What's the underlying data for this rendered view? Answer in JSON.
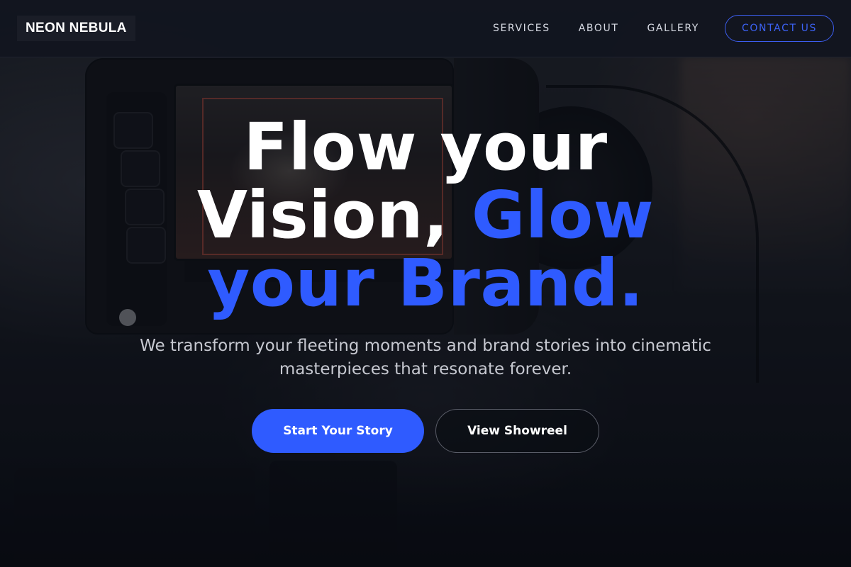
{
  "brand": {
    "logo_text": "NEON NEBULA"
  },
  "nav": {
    "links": [
      {
        "label": "SERVICES"
      },
      {
        "label": "ABOUT"
      },
      {
        "label": "GALLERY"
      }
    ],
    "cta_label": "CONTACT US"
  },
  "hero": {
    "title_line1": "Flow your",
    "title_line2_white": "Vision, ",
    "title_line2_accent": "Glow",
    "title_line3": "your Brand.",
    "subtitle": "We transform your fleeting moments and brand stories into cinematic masterpieces that resonate forever.",
    "primary_button": "Start Your Story",
    "secondary_button": "View Showreel"
  },
  "colors": {
    "accent": "#2f5bff",
    "nav_background": "#12151f",
    "text_primary": "#ffffff",
    "text_muted": "#c6c8d0"
  },
  "background": {
    "subject": "camera-monitor-photo"
  }
}
